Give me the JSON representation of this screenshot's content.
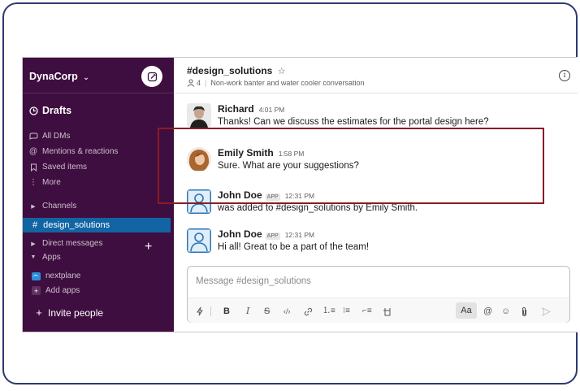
{
  "workspace": {
    "name": "DynaCorp",
    "chevron": "⌄"
  },
  "sidebar": {
    "drafts": "Drafts",
    "items": [
      {
        "label": "All DMs",
        "icon": "dm-icon"
      },
      {
        "label": "Mentions & reactions",
        "icon": "at-icon"
      },
      {
        "label": "Saved items",
        "icon": "bookmark-icon"
      },
      {
        "label": "More",
        "icon": "more-icon"
      }
    ],
    "channels_label": "Channels",
    "active_channel": "design_solutions",
    "direct_messages_label": "Direct messages",
    "apps_label": "Apps",
    "app_item": "nextplane",
    "add_apps": "Add apps",
    "invite": "Invite people"
  },
  "channel": {
    "title": "#design_solutions",
    "members": "4",
    "description": "Non-work banter and water cooler conversation"
  },
  "messages": [
    {
      "sender": "Richard",
      "badge": "",
      "time": "4:01 PM",
      "text": "Thanks! Can we discuss the estimates for the portal design here?"
    },
    {
      "sender": "Emily Smith",
      "badge": "",
      "time": "1:58 PM",
      "text": "Sure. What are your suggestions?"
    },
    {
      "sender": "John Doe",
      "badge": "APP",
      "time": "12:31 PM",
      "text": "was added to #design_solutions by Emily Smith."
    },
    {
      "sender": "John Doe",
      "badge": "APP",
      "time": "12:31 PM",
      "text": "Hi all! Great to be a part of the team!"
    }
  ],
  "composer": {
    "placeholder": "Message #design_solutions",
    "format_label": "Aa"
  },
  "colors": {
    "sidebar_bg": "#3f0e40",
    "active_channel": "#1264a3",
    "highlight_border": "#8a1c24",
    "frame_border": "#2c3a70"
  }
}
